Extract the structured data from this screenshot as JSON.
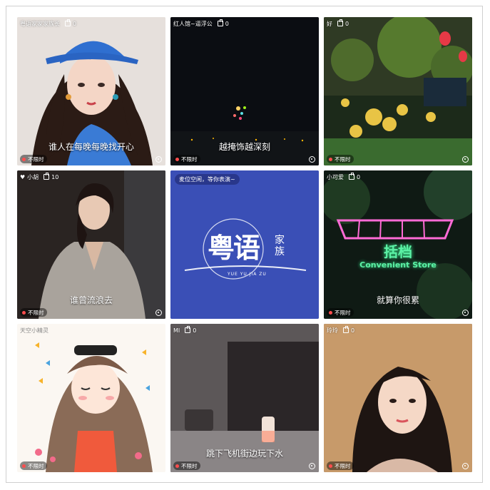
{
  "tiles": [
    {
      "user": "粤语家家家族长",
      "gifts": "0",
      "caption": "谁人在每晚每晚找开心",
      "badge": "不限时"
    },
    {
      "user": "红人馆~逼浮公",
      "gifts": "0",
      "caption": "越掩饰越深刻",
      "badge": "不限时"
    },
    {
      "user": "好",
      "gifts": "0",
      "caption": "",
      "badge": "不限时"
    },
    {
      "user": "小胡",
      "gifts": "10",
      "caption": "谁曾流浪去",
      "badge": "不限时"
    },
    {
      "user": "",
      "gifts": "",
      "caption": "",
      "badge": "",
      "banner": "麦位空闲，等你表演~",
      "logo_main": "粤语",
      "logo_side": "家族",
      "logo_sub": "YUE YU JIA ZU"
    },
    {
      "user": "小可爱",
      "gifts": "0",
      "caption": "就算你很累",
      "badge": "不限时",
      "sign_main": "括档",
      "sign_sub": "Convenient Store"
    },
    {
      "user": "天空小精灵",
      "gifts": "",
      "caption": "",
      "badge": "不限时"
    },
    {
      "user": "MI",
      "gifts": "0",
      "caption": "跳下飞机街边玩下水",
      "badge": "不限时"
    },
    {
      "user": "玲玲",
      "gifts": "0",
      "caption": "",
      "badge": "不限时"
    }
  ]
}
